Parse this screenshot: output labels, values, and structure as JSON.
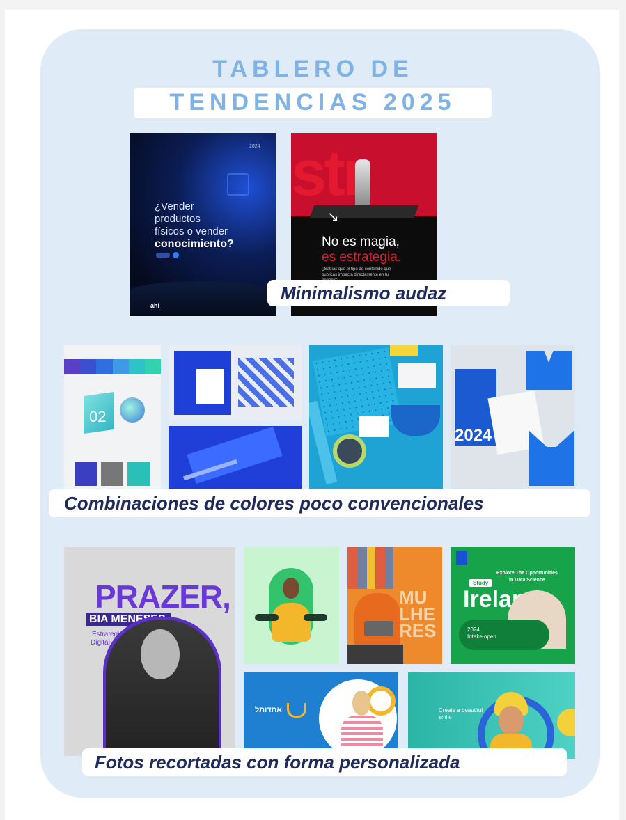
{
  "title": {
    "line1": "TABLERO DE",
    "line2": "TENDENCIAS 2025"
  },
  "colors": {
    "accent": "#7fb3e6",
    "panel": "#dfebf7",
    "label_text": "#1f2b5b"
  },
  "section1": {
    "label": "Minimalismo audaz",
    "card1": {
      "line1": "¿Vender",
      "line2": "productos",
      "line3": "físicos o vender",
      "line4": "conocimiento?",
      "top_right": "2024",
      "brand": "ahí"
    },
    "card2": {
      "big": "str",
      "line1": "No es magia,",
      "line2": "es estrategia.",
      "small": "¿Sabías que el tipo de contenido que publicas impacta directamente en tu negocio?"
    }
  },
  "section2": {
    "label": "Combinaciones de colores poco convencionales",
    "palette_number": "02",
    "year": "2024"
  },
  "section3": {
    "label": "Fotos recortadas con forma personalizada",
    "prazer": {
      "title": "PRAZER,",
      "name": "BIA MENESES,",
      "role_line1": "Estrategista",
      "role_line2": "Digital e CEO"
    },
    "mulheres": "MU\nLHE\nRES",
    "ireland": {
      "headline_line1": "Explore The Opportunities",
      "headline_line2": "in Data Science",
      "study": "Study",
      "country": "Ireland",
      "intake": "2024",
      "intake_open": "Intake open"
    },
    "banner_text": "Create a beautiful smile"
  }
}
